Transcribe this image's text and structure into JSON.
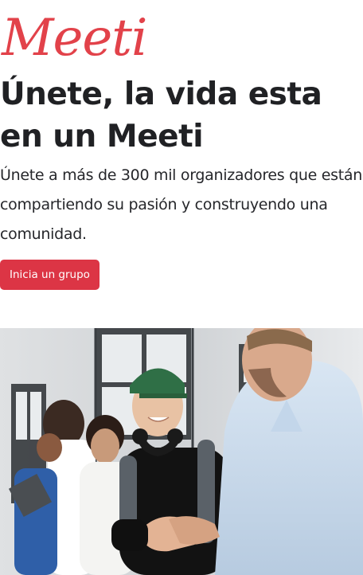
{
  "brand": {
    "logo_text": "Meeti",
    "accent_color": "#e2424a"
  },
  "hero": {
    "title": "Únete, la vida esta en un Meeti",
    "subtitle": "Únete a más de 300 mil organizadores que están compartiendo su pasión y construyendo una comunidad.",
    "cta_label": "Inicia un grupo",
    "cta_color": "#dc3545"
  },
  "image": {
    "description_icon": "photo-people-handshake"
  }
}
